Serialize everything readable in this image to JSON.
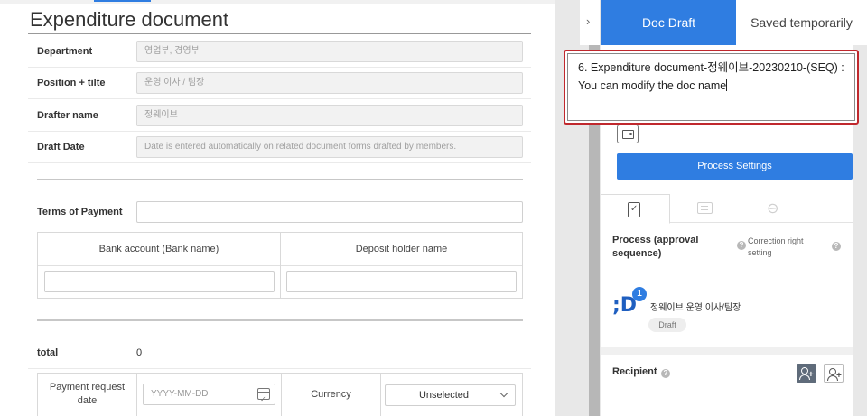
{
  "document": {
    "title": "Expenditure document",
    "fields": {
      "department": {
        "label": "Department",
        "value": "영업부, 경영부"
      },
      "position": {
        "label": "Position + tilte",
        "value": "운영 이사 / 팀장"
      },
      "drafter": {
        "label": "Drafter name",
        "value": "정웨이브"
      },
      "draft_date": {
        "label": "Draft Date",
        "value": "Date is entered automatically on related document forms drafted by members."
      }
    },
    "terms_of_payment": {
      "label": "Terms of Payment",
      "value": ""
    },
    "bank_table": {
      "col1_header": "Bank account (Bank name)",
      "col2_header": "Deposit holder name"
    },
    "total": {
      "label": "total",
      "value": "0"
    },
    "payment": {
      "request_date_label": "Payment request date",
      "date_placeholder": "YYYY-MM-DD",
      "currency_label": "Currency",
      "currency_value": "Unselected"
    }
  },
  "right_panel": {
    "collapse_glyph": "›",
    "tabs": {
      "draft": "Doc Draft",
      "saved": "Saved temporarily"
    },
    "doc_name": "6. Expenditure document-정웨이브-20230210-(SEQ) : You can modify the doc name",
    "process_settings_label": "Process Settings",
    "process_title": "Process (approval sequence)",
    "help_glyph": "?",
    "correction_label": "Correction right setting",
    "approver": {
      "avatar_letter": ";D",
      "order": "1",
      "name": "정웨이브 운영 이사/팀장",
      "status": "Draft"
    },
    "recipient_label": "Recipient",
    "add_glyph": "+"
  },
  "colors": {
    "accent": "#2f7de1",
    "highlight_border": "#c0282d"
  },
  "icons": [
    "chevron-right-icon",
    "wallet-icon",
    "document-check-icon",
    "comment-icon",
    "paperclip-icon",
    "calendar-icon",
    "chevron-down-icon",
    "add-person-icon",
    "help-icon"
  ]
}
